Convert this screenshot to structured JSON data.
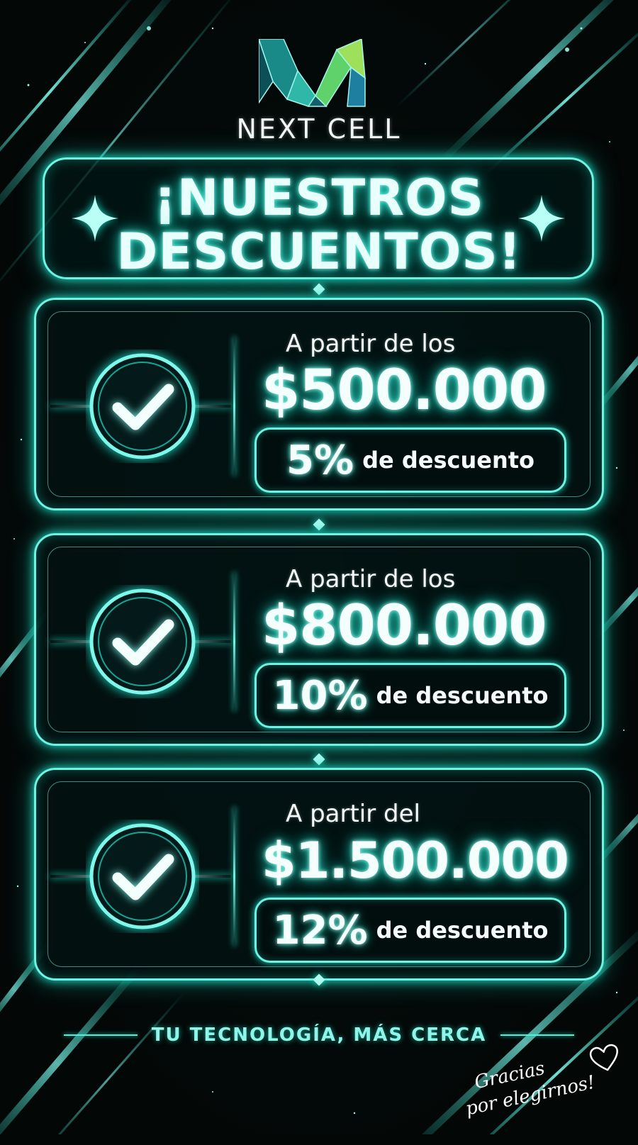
{
  "brand": {
    "name": "NEXT CELL",
    "logo": "nc-logo-icon"
  },
  "title": {
    "line1": "¡NUESTROS",
    "line2": "DESCUENTOS!"
  },
  "tiers": [
    {
      "prefix": "A partir de los",
      "amount": "$500.000",
      "percent": "5%",
      "suffix": "de descuento"
    },
    {
      "prefix": "A partir de los",
      "amount": "$800.000",
      "percent": "10%",
      "suffix": "de descuento"
    },
    {
      "prefix": "A partir del",
      "amount": "$1.500.000",
      "percent": "12%",
      "suffix": "de descuento"
    }
  ],
  "footer": {
    "tagline": "TU TECNOLOGÍA, MÁS CERCA",
    "thanks_line1": "Gracias",
    "thanks_line2": "por elegirnos!"
  },
  "colors": {
    "accent": "#1fe0c8",
    "glow": "#6ff3e2",
    "background": "#030807"
  },
  "icons": [
    "sparkle-icon",
    "check-icon",
    "heart-icon"
  ]
}
